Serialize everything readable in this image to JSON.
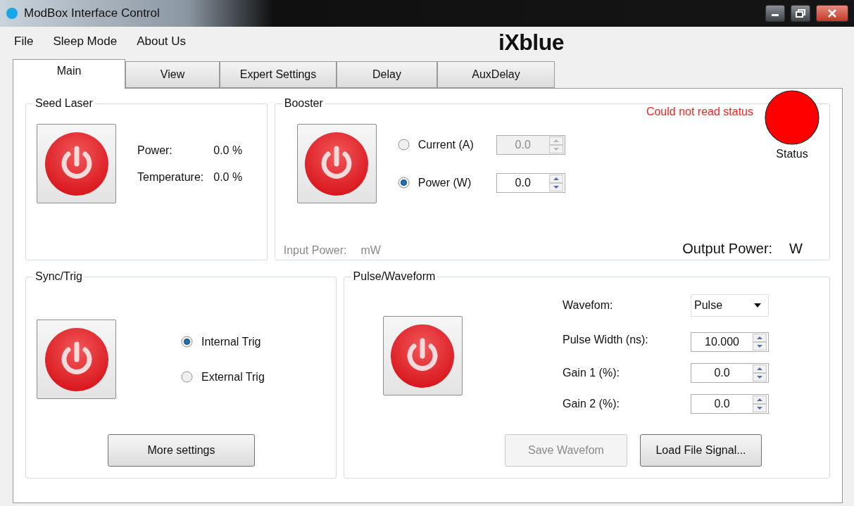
{
  "window": {
    "title": "ModBox Interface Control"
  },
  "menu": [
    "File",
    "Sleep Mode",
    "About Us"
  ],
  "logo": "iXblue",
  "tabs": [
    {
      "label": "Main",
      "selected": true
    },
    {
      "label": "View",
      "selected": false
    },
    {
      "label": "Expert Settings",
      "selected": false
    },
    {
      "label": "Delay",
      "selected": false
    },
    {
      "label": "AuxDelay",
      "selected": false
    }
  ],
  "seed_laser": {
    "title": "Seed Laser",
    "readings": [
      {
        "label": "Power:",
        "value": "0.0 %"
      },
      {
        "label": "Temperature:",
        "value": "0.0 %"
      }
    ]
  },
  "booster": {
    "title": "Booster",
    "status_message": "Could not read status",
    "status_ok": false,
    "status_label": "Status",
    "modes": [
      {
        "label": "Current (A)",
        "selected": false,
        "value": "0.0",
        "disabled": true
      },
      {
        "label": "Power (W)",
        "selected": true,
        "value": "0.0",
        "disabled": false
      }
    ],
    "input_power": {
      "label": "Input Power:",
      "unit": "mW"
    },
    "output_power": {
      "label": "Output Power:",
      "unit": "W"
    }
  },
  "sync_trig": {
    "title": "Sync/Trig",
    "options": [
      {
        "label": "Internal Trig",
        "selected": true
      },
      {
        "label": "External Trig",
        "selected": false
      }
    ],
    "button": "More settings"
  },
  "pulse_waveform": {
    "title": "Pulse/Waveform",
    "fields": [
      {
        "kind": "dropdown",
        "label": "Wavefom:",
        "value": "Pulse"
      },
      {
        "kind": "spinner",
        "label": "Pulse Width (ns):",
        "value": "10.000"
      },
      {
        "kind": "spinner",
        "label": "Gain 1 (%):",
        "value": "0.0"
      },
      {
        "kind": "spinner",
        "label": "Gain 2 (%):",
        "value": "0.0"
      }
    ],
    "buttons": [
      {
        "label": "Save Wavefom",
        "disabled": true
      },
      {
        "label": "Load File Signal...",
        "disabled": false
      }
    ]
  }
}
